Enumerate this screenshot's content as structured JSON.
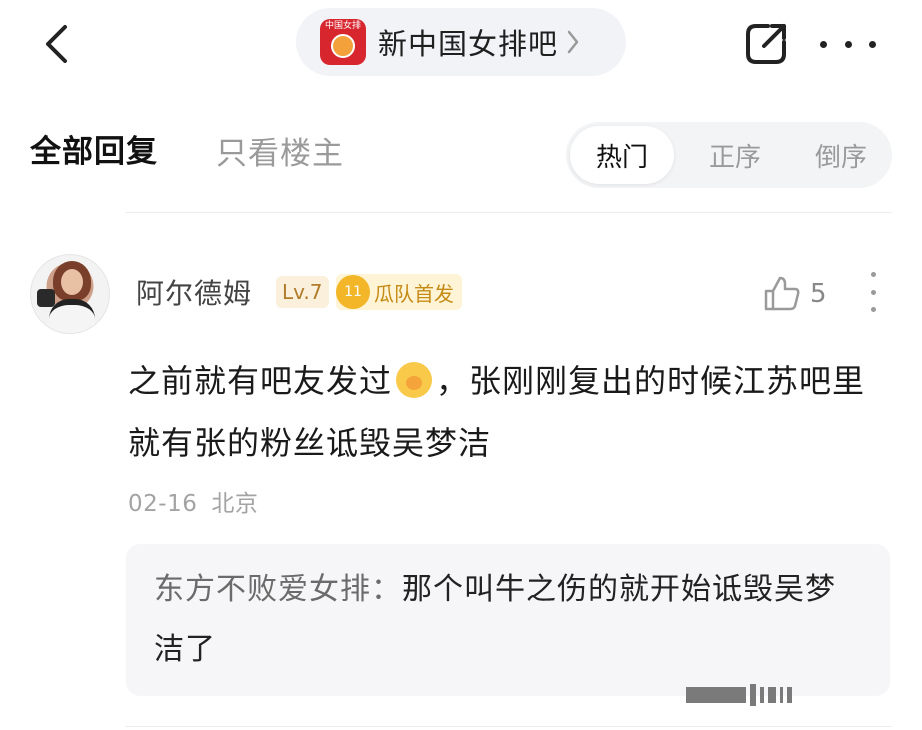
{
  "header": {
    "back_icon": "chevron-left-icon",
    "forum_logo_text": "中国女排",
    "forum_name": "新中国女排吧",
    "share_icon": "share-icon",
    "more_icon": "more-horizontal-icon"
  },
  "tabs": {
    "all_replies": "全部回复",
    "op_only": "只看楼主"
  },
  "sort": {
    "hot": "热门",
    "asc": "正序",
    "desc": "倒序",
    "selected": "热门"
  },
  "comment": {
    "username": "阿尔德姆",
    "level": "Lv.7",
    "fan_level": "11",
    "fan_badge": "瓜队首发",
    "likes": "5",
    "text_part1": "之前就有吧友发过",
    "text_part2": "，张刚刚复出的时候江苏吧里就有张的粉丝诋毁吴梦洁",
    "date": "02-16",
    "location": "北京",
    "reply": {
      "author": "东方不败爱女排：",
      "text": "那个叫牛之伤的就开始诋毁吴梦洁了"
    }
  },
  "colors": {
    "accent_red": "#d8262f",
    "badge_gold": "#f2b628"
  }
}
